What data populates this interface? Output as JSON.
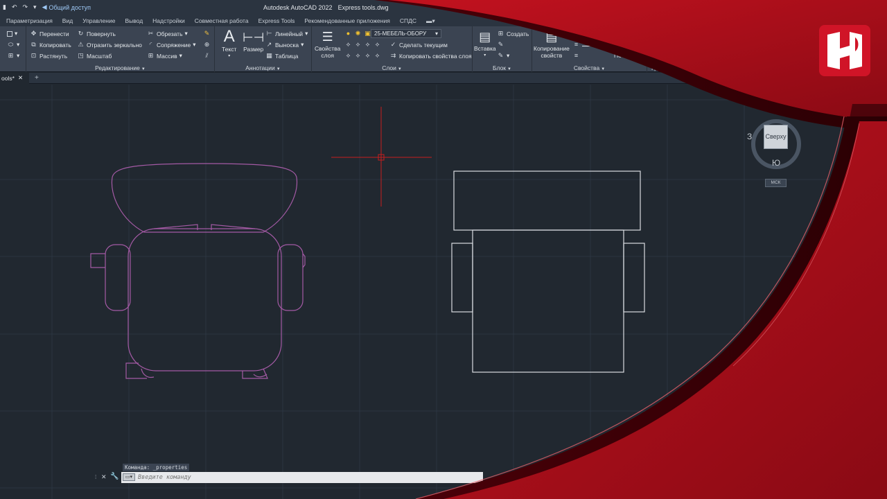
{
  "titlebar": {
    "share_label": "Общий доступ",
    "app_name": "Autodesk AutoCAD 2022",
    "file_name": "Express tools.dwg"
  },
  "menu": {
    "tabs": [
      "Параметризация",
      "Вид",
      "Управление",
      "Вывод",
      "Надстройки",
      "Совместная работа",
      "Express Tools",
      "Рекомендованные приложения",
      "СПДС"
    ]
  },
  "ribbon": {
    "modify": {
      "title": "Редактирование",
      "move": "Перенести",
      "rotate": "Повернуть",
      "trim": "Обрезать",
      "copy": "Копировать",
      "mirror": "Отразить зеркально",
      "fillet": "Сопряжение",
      "stretch": "Растянуть",
      "scale": "Масштаб",
      "array": "Массив"
    },
    "annotation": {
      "title": "Аннотации",
      "text": "Текст",
      "dimension": "Размер",
      "linear": "Линейный",
      "leader": "Выноска",
      "table": "Таблица"
    },
    "layers": {
      "title": "Слои",
      "layer_props_line1": "Свойства",
      "layer_props_line2": "слоя",
      "current_layer": "25-МЕБЕЛЬ-ОБОРУ",
      "make_current": "Сделать текущим",
      "match_layer": "Копировать свойства слоя"
    },
    "block": {
      "title": "Блок",
      "insert": "Вставка",
      "create": "Создать"
    },
    "properties": {
      "title": "Свойства",
      "match_line1": "Копирование",
      "match_line2": "свойств",
      "bylayer": "ПоСл..."
    },
    "groups": {
      "title": "Груп"
    }
  },
  "filetabs": {
    "active_tab": "ools*"
  },
  "viewcube": {
    "face": "Сверху",
    "west": "З",
    "south": "Ю",
    "ucs": "МСК"
  },
  "command": {
    "history": "Команда: _properties",
    "placeholder": "Введите команду"
  },
  "colors": {
    "background": "#212830",
    "grid_major": "#2c3541",
    "drawing_magenta": "#a45aa5",
    "drawing_white": "#d9dde2",
    "cursor_red": "#c81e1e",
    "overlay_red": "#b0101c"
  }
}
